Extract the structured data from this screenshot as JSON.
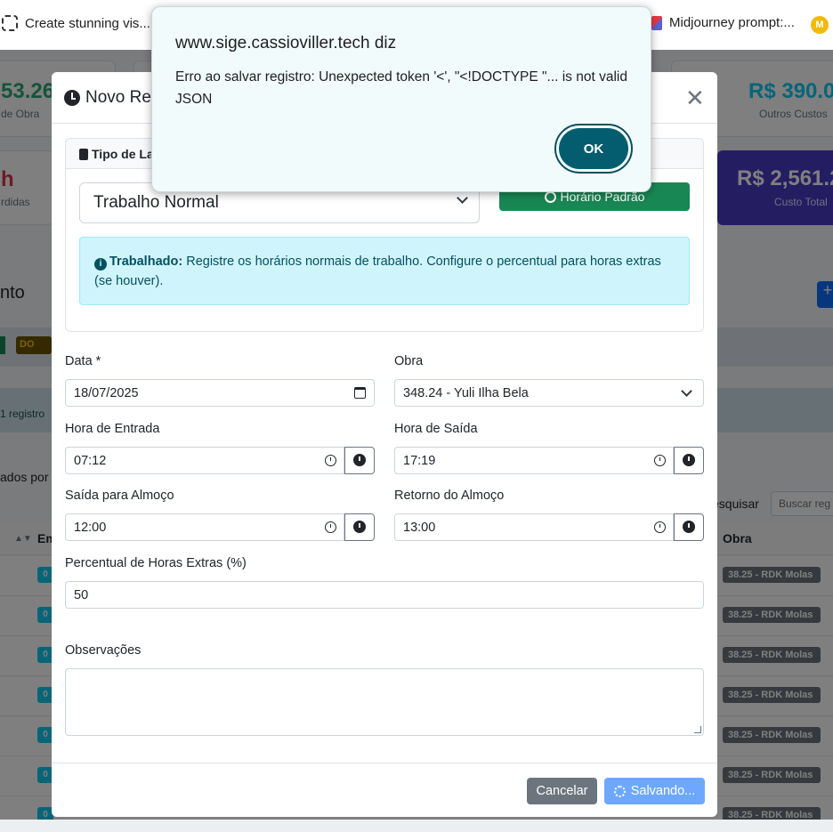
{
  "bookmarks": {
    "item1_label": "Create stunning vis...",
    "item2_label": "Midjourney prompt:...",
    "coin_letter": "M"
  },
  "background": {
    "stat1_value": "53.26",
    "stat1_label": "de Obra",
    "stat2_value": "R$ 390.0",
    "stat2_label": "Outros Custos",
    "stat3_value": "h",
    "stat3_label": "rdidas",
    "stat4_value": "R$ 2,561.2",
    "stat4_label": "Custo Total",
    "section_title": "nto",
    "plus": "+",
    "tag_label": "DO",
    "records_text": "1 registro",
    "dados_text": "ados por",
    "pesquisar_label": "esquisar",
    "search_placeholder": "Buscar reg",
    "col_em": "Em",
    "col_obra": "Obra",
    "rows": [
      {
        "badge": "0",
        "obra": "38.25 - RDK Molas"
      },
      {
        "badge": "0",
        "obra": "38.25 - RDK Molas"
      },
      {
        "badge": "0",
        "obra": "38.25 - RDK Molas"
      },
      {
        "badge": "0",
        "obra": "38.25 - RDK Molas"
      },
      {
        "badge": "0",
        "obra": "38.25 - RDK Molas"
      },
      {
        "badge": "0",
        "obra": "38.25 - RDK Molas"
      },
      {
        "badge": "0",
        "obra": "38.25 - RDK Molas"
      }
    ]
  },
  "modal": {
    "title": "Novo Reg",
    "tipo_title": "Tipo de La",
    "tipo_select": "Trabalho Normal",
    "horario_padrao": "Horário Padrão",
    "info_bold": "Trabalhado:",
    "info_text": " Registre os horários normais de trabalho. Configure o percentual para horas extras (se houver).",
    "data_label": "Data *",
    "data_value": "18/07/2025",
    "obra_label": "Obra",
    "obra_value": "348.24 - Yuli Ilha Bela",
    "entrada_label": "Hora de Entrada",
    "entrada_value": "07:12",
    "saida_label": "Hora de Saída",
    "saida_value": "17:19",
    "almoco_saida_label": "Saída para Almoço",
    "almoco_saida_value": "12:00",
    "almoco_retorno_label": "Retorno do Almoço",
    "almoco_retorno_value": "13:00",
    "percentual_label": "Percentual de Horas Extras (%)",
    "percentual_value": "50",
    "observacoes_label": "Observações",
    "observacoes_value": "",
    "cancel_label": "Cancelar",
    "save_label": "Salvando..."
  },
  "alert": {
    "title": "www.sige.cassioviller.tech diz",
    "message": "Erro ao salvar registro: Unexpected token '<', \"<!DOCTYPE \"... is not valid JSON",
    "ok_label": "OK"
  },
  "colors": {
    "primary": "#0d6efd",
    "success": "#198754",
    "info_bg": "#cff4fc",
    "alert_ok": "#045d6e"
  }
}
